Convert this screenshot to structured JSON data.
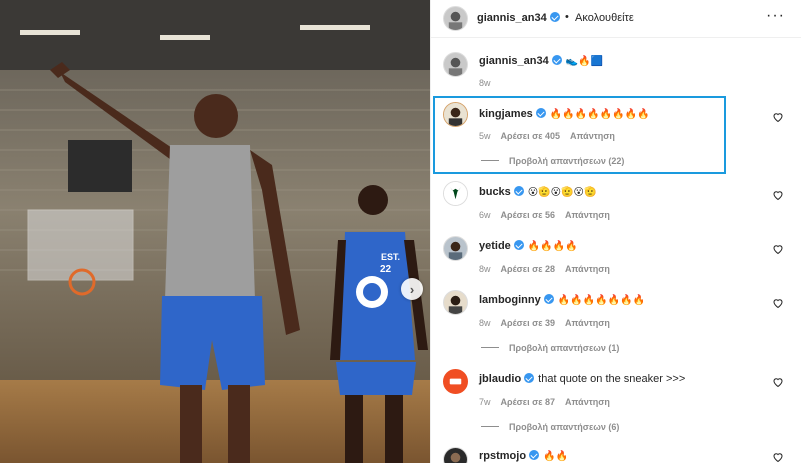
{
  "header": {
    "username": "giannis_an34",
    "dot": "•",
    "follow_label": "Ακολουθείτε",
    "more_icon": "more-icon"
  },
  "caption": {
    "username": "giannis_an34",
    "text": "👟🔥🟦",
    "age": "8w"
  },
  "comments": [
    {
      "username": "kingjames",
      "text": "🔥🔥🔥🔥🔥🔥🔥🔥",
      "age": "5w",
      "likes": "Αρέσει σε 405",
      "reply": "Απάντηση",
      "replies": "Προβολή απαντήσεων (22)"
    },
    {
      "username": "bucks",
      "text": "😮🫡😮🫡😮🫡",
      "age": "6w",
      "likes": "Αρέσει σε 56",
      "reply": "Απάντηση"
    },
    {
      "username": "yetide",
      "text": "🔥🔥🔥🔥",
      "age": "8w",
      "likes": "Αρέσει σε 28",
      "reply": "Απάντηση"
    },
    {
      "username": "lamboginny",
      "text": "🔥🔥🔥🔥🔥🔥🔥",
      "age": "8w",
      "likes": "Αρέσει σε 39",
      "reply": "Απάντηση",
      "replies": "Προβολή απαντήσεων (1)"
    },
    {
      "username": "jblaudio",
      "text": "that quote on the sneaker >>>",
      "age": "7w",
      "likes": "Αρέσει σε 87",
      "reply": "Απάντηση",
      "replies": "Προβολή απαντήσεων (6)"
    },
    {
      "username": "rpstmojo",
      "text": "🔥🔥"
    }
  ],
  "photo": {
    "jersey_text": "EST.",
    "jersey_number": "22",
    "next_arrow": "›"
  },
  "colors": {
    "highlight": "#1a9ade",
    "verified": "#3897f0",
    "muted": "#8e8e8e"
  }
}
